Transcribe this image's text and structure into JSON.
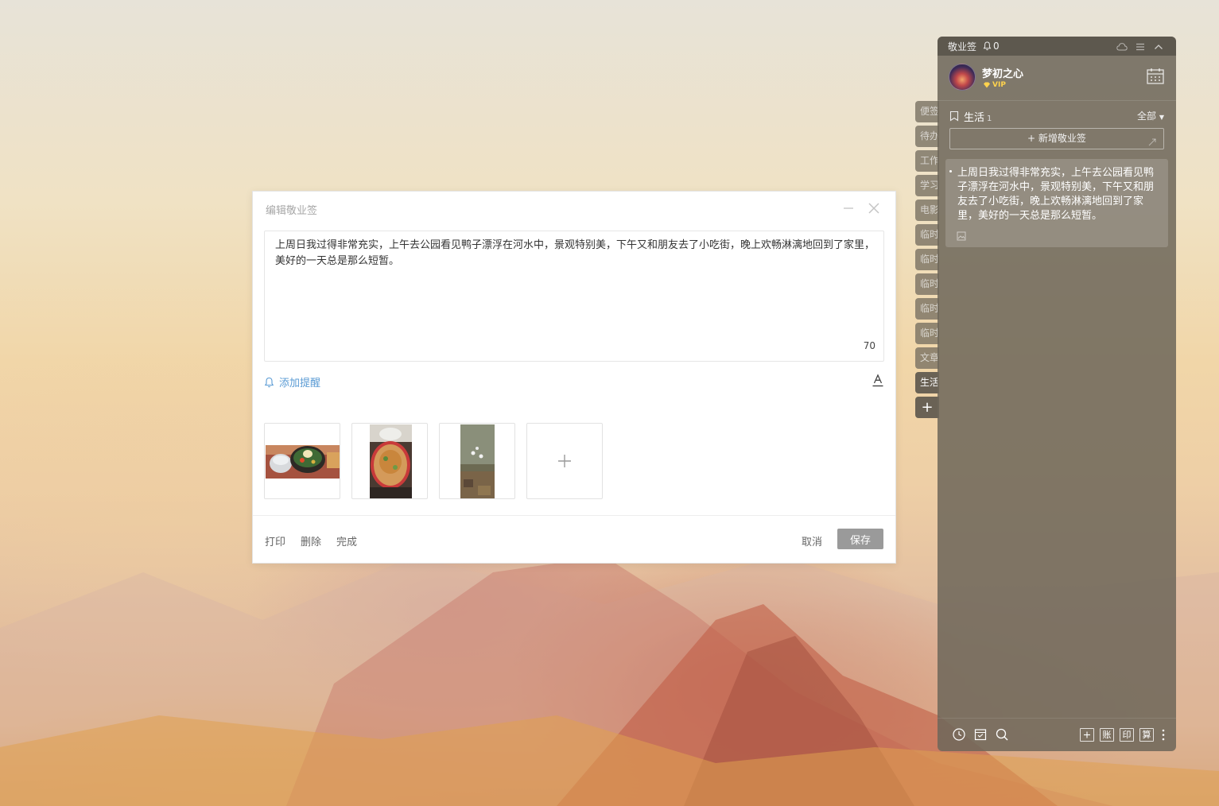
{
  "dialog": {
    "title": "编辑敬业签",
    "content": "上周日我过得非常充实，上午去公园看见鸭子漂浮在河水中，景观特别美，下午又和朋友去了小吃街，晚上欢畅淋漓地回到了家里，美好的一天总是那么短暂。",
    "char_count": "70",
    "reminder_label": "添加提醒",
    "footer": {
      "print_label": "打印",
      "delete_label": "删除",
      "done_label": "完成",
      "cancel_label": "取消",
      "save_label": "保存"
    }
  },
  "side_tabs": [
    {
      "label": "便签"
    },
    {
      "label": "待办"
    },
    {
      "label": "工作"
    },
    {
      "label": "学习"
    },
    {
      "label": "电影"
    },
    {
      "label": "临时"
    },
    {
      "label": "临时"
    },
    {
      "label": "临时"
    },
    {
      "label": "临时"
    },
    {
      "label": "临时"
    },
    {
      "label": "文章"
    },
    {
      "label": "生活",
      "active": true
    },
    {
      "label": "+"
    }
  ],
  "panel": {
    "app_name": "敬业签",
    "reminder_count": "0",
    "user": {
      "name": "梦初之心",
      "badge": "VIP"
    },
    "category": {
      "name": "生活",
      "count": "1",
      "filter": "全部"
    },
    "add_note_label": "新增敬业签",
    "notes": [
      {
        "text": "上周日我过得非常充实，上午去公园看见鸭子漂浮在河水中，景观特别美，下午又和朋友去了小吃街，晚上欢畅淋漓地回到了家里，美好的一天总是那么短暂。"
      }
    ],
    "bottom_tools": {
      "account_label": "账",
      "print_label": "印",
      "calc_label": "算"
    }
  },
  "colors": {
    "accent_link": "#5a9bd4",
    "save_button": "#9a9a9a",
    "vip": "#ffd34d"
  },
  "icons": [
    "minimize-icon",
    "close-icon",
    "bell-icon",
    "font-color-icon",
    "plus-icon",
    "cloud-icon",
    "menu-icon",
    "collapse-icon",
    "calendar-icon",
    "bookmark-icon",
    "expand-icon",
    "image-icon",
    "clock-icon",
    "archive-icon",
    "search-icon",
    "more-icon",
    "diamond-icon"
  ]
}
